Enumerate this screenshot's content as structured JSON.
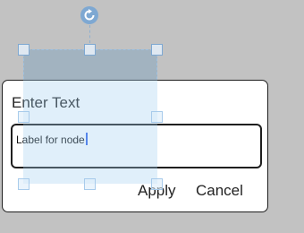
{
  "dialog": {
    "title": "Enter Text",
    "input_value": "Label for node",
    "apply_label": "Apply",
    "cancel_label": "Cancel"
  },
  "icons": {
    "rotate": "rotate-icon"
  },
  "colors": {
    "background": "#c2c2c2",
    "selected_shape": "#a2b3c0",
    "selection_handle": "#7ea8d2",
    "caret": "#3465e8"
  }
}
